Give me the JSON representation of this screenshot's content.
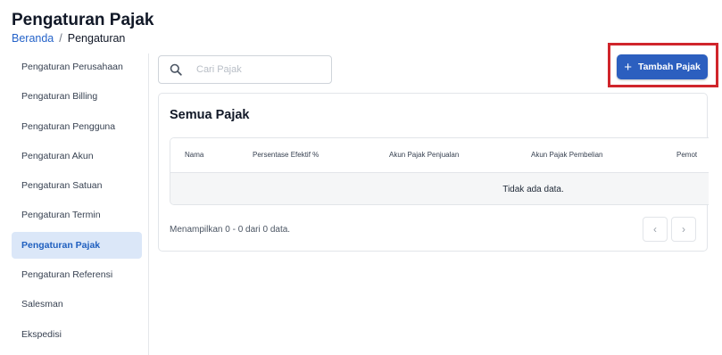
{
  "page": {
    "title": "Pengaturan Pajak",
    "breadcrumb": {
      "home": "Beranda",
      "separator": "/",
      "current": "Pengaturan"
    }
  },
  "sidebar": {
    "items": [
      {
        "label": "Pengaturan Perusahaan",
        "active": false
      },
      {
        "label": "Pengaturan Billing",
        "active": false
      },
      {
        "label": "Pengaturan Pengguna",
        "active": false
      },
      {
        "label": "Pengaturan Akun",
        "active": false
      },
      {
        "label": "Pengaturan Satuan",
        "active": false
      },
      {
        "label": "Pengaturan Termin",
        "active": false
      },
      {
        "label": "Pengaturan Pajak",
        "active": true
      },
      {
        "label": "Pengaturan Referensi",
        "active": false
      },
      {
        "label": "Salesman",
        "active": false
      },
      {
        "label": "Ekspedisi",
        "active": false
      }
    ]
  },
  "search": {
    "placeholder": "Cari Pajak",
    "value": "",
    "icon": "search-icon"
  },
  "toolbar": {
    "add_label": "Tambah Pajak",
    "add_icon": "plus-icon"
  },
  "card": {
    "title": "Semua Pajak",
    "table": {
      "columns": [
        "Nama",
        "Persentase Efektif %",
        "Akun Pajak Penjualan",
        "Akun Pajak Pembelian",
        "Pemot"
      ],
      "empty_text": "Tidak ada data."
    },
    "footer": "Menampilkan 0 - 0 dari 0 data.",
    "pagination": {
      "prev": "‹",
      "next": "›"
    }
  },
  "colors": {
    "primary": "#2c5fbf",
    "active_bg": "#dbe7f8",
    "highlight": "#d0252b",
    "link": "#2563c9"
  }
}
